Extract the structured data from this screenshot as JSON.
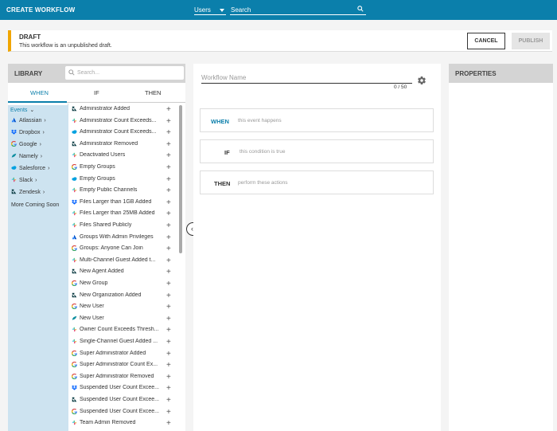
{
  "header": {
    "title": "CREATE WORKFLOW",
    "scope_value": "Users",
    "search_placeholder": "Search"
  },
  "draft": {
    "title": "DRAFT",
    "subtitle": "This workflow is an unpublished draft.",
    "cancel_label": "CANCEL",
    "publish_label": "PUBLISH"
  },
  "library": {
    "title": "LIBRARY",
    "search_placeholder": "Search...",
    "tabs": [
      "WHEN",
      "IF",
      "THEN"
    ],
    "sources": [
      {
        "label": "Events",
        "icon": "chevron-down-icon"
      },
      {
        "label": "Atlassian",
        "icon": "atlassian-icon"
      },
      {
        "label": "Dropbox",
        "icon": "dropbox-icon"
      },
      {
        "label": "Google",
        "icon": "google-icon"
      },
      {
        "label": "Namely",
        "icon": "namely-icon"
      },
      {
        "label": "Salesforce",
        "icon": "salesforce-icon"
      },
      {
        "label": "Slack",
        "icon": "slack-icon"
      },
      {
        "label": "Zendesk",
        "icon": "zendesk-icon"
      },
      {
        "label": "More Coming Soon",
        "icon": ""
      }
    ],
    "events": [
      {
        "label": "Administrator Added",
        "icon": "zendesk"
      },
      {
        "label": "Administrator Count Exceeds...",
        "icon": "slack"
      },
      {
        "label": "Administrator Count Exceeds...",
        "icon": "salesforce"
      },
      {
        "label": "Administrator Removed",
        "icon": "zendesk"
      },
      {
        "label": "Deactivated Users",
        "icon": "slack"
      },
      {
        "label": "Empty Groups",
        "icon": "google"
      },
      {
        "label": "Empty Groups",
        "icon": "salesforce"
      },
      {
        "label": "Empty Public Channels",
        "icon": "slack"
      },
      {
        "label": "Files Larger than 1GB Added",
        "icon": "dropbox"
      },
      {
        "label": "Files Larger than 25MB Added",
        "icon": "slack"
      },
      {
        "label": "Files Shared Publicly",
        "icon": "slack"
      },
      {
        "label": "Groups With Admin Privileges",
        "icon": "atlassian"
      },
      {
        "label": "Groups: Anyone Can Join",
        "icon": "google"
      },
      {
        "label": "Multi-Channel Guest Added t...",
        "icon": "slack"
      },
      {
        "label": "New Agent Added",
        "icon": "zendesk"
      },
      {
        "label": "New Group",
        "icon": "google"
      },
      {
        "label": "New Organization Added",
        "icon": "zendesk"
      },
      {
        "label": "New User",
        "icon": "google"
      },
      {
        "label": "New User",
        "icon": "namely"
      },
      {
        "label": "Owner Count Exceeds Thresh...",
        "icon": "slack"
      },
      {
        "label": "Single-Channel Guest Added ...",
        "icon": "slack"
      },
      {
        "label": "Super Administrator Added",
        "icon": "google"
      },
      {
        "label": "Super Administrator Count Ex...",
        "icon": "google"
      },
      {
        "label": "Super Administrator Removed",
        "icon": "google"
      },
      {
        "label": "Suspended User Count Excee...",
        "icon": "dropbox"
      },
      {
        "label": "Suspended User Count Excee...",
        "icon": "zendesk"
      },
      {
        "label": "Suspended User Count Excee...",
        "icon": "google"
      },
      {
        "label": "Team Admin Removed",
        "icon": "slack"
      }
    ]
  },
  "workflow": {
    "name_placeholder": "Workflow Name",
    "counter": "0 / 50",
    "steps": [
      {
        "key": "WHEN",
        "desc": "this event happens",
        "color": "#0b7fab"
      },
      {
        "key": "IF",
        "desc": "this condition is true",
        "color": "#333333"
      },
      {
        "key": "THEN",
        "desc": "perform these actions",
        "color": "#333333"
      }
    ]
  },
  "properties": {
    "title": "PROPERTIES"
  },
  "colors": {
    "accent": "#0b7fab",
    "draft": "#f0a500"
  }
}
